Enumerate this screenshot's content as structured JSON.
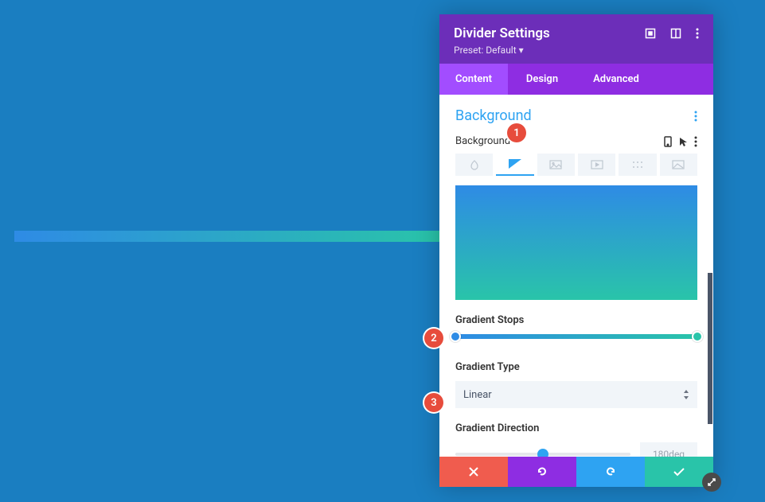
{
  "header": {
    "title": "Divider Settings",
    "preset": "Preset: Default ▾"
  },
  "tabs": {
    "content": "Content",
    "design": "Design",
    "advanced": "Advanced"
  },
  "section": {
    "title": "Background",
    "label": "Background"
  },
  "gradient": {
    "stops_label": "Gradient Stops",
    "type_label": "Gradient Type",
    "type_value": "Linear",
    "direction_label": "Gradient Direction",
    "direction_value": "180deg",
    "start_color": "#2e8be5",
    "end_color": "#29c4a9"
  },
  "callouts": {
    "c1": "1",
    "c2": "2",
    "c3": "3"
  }
}
